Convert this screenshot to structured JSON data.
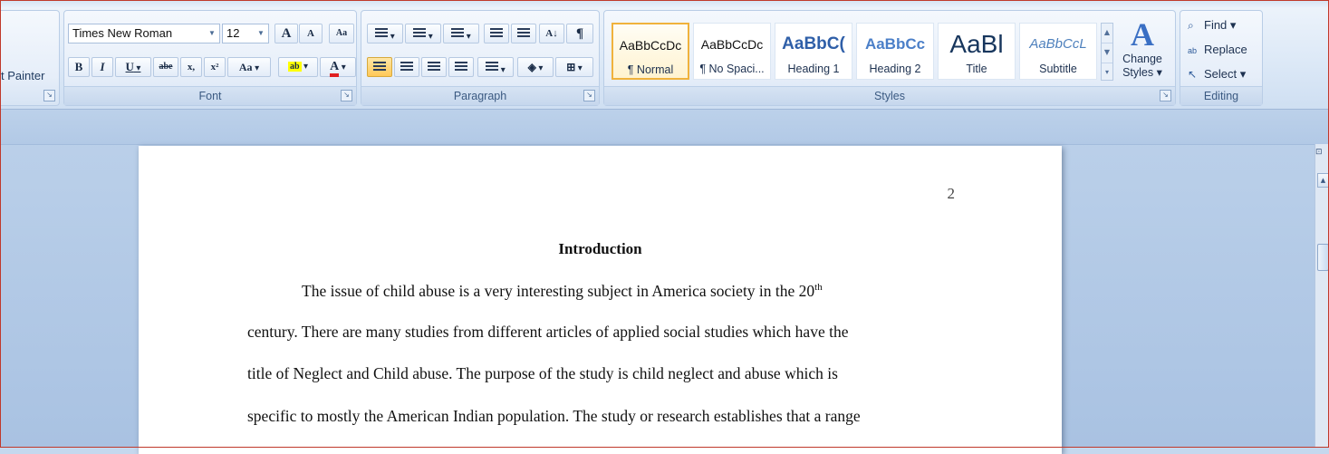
{
  "clipboard": {
    "painter_label": "t Painter"
  },
  "font": {
    "group_label": "Font",
    "face": "Times New Roman",
    "size": "12",
    "grow_label": "A",
    "shrink_label": "A",
    "clear_label": "Aa",
    "bold": "B",
    "italic": "I",
    "underline": "U",
    "strike": "abe",
    "subscript": "x,",
    "superscript": "x²",
    "change_case": "Aa",
    "highlight": "ab",
    "font_color": "A"
  },
  "paragraph": {
    "group_label": "Paragraph",
    "show_marks": "¶",
    "sort": "A↓"
  },
  "styles": {
    "group_label": "Styles",
    "tiles": [
      {
        "preview": "AaBbCcDc",
        "name": "¶ Normal"
      },
      {
        "preview": "AaBbCcDc",
        "name": "¶ No Spaci..."
      },
      {
        "preview": "AaBbC(",
        "name": "Heading 1"
      },
      {
        "preview": "AaBbCc",
        "name": "Heading 2"
      },
      {
        "preview": "AaBl",
        "name": "Title"
      },
      {
        "preview": "AaBbCcL",
        "name": "Subtitle"
      }
    ],
    "change_styles": {
      "line1": "Change",
      "line2": "Styles ▾"
    }
  },
  "editing": {
    "group_label": "Editing",
    "find": "Find ▾",
    "replace": "Replace",
    "select": "Select ▾"
  },
  "document": {
    "page_number": "2",
    "heading": "Introduction",
    "lines": [
      "The issue of child abuse is a very interesting subject in America society in the 20",
      "century. There are many studies from different articles of applied social studies which have the",
      "title of Neglect and Child abuse. The purpose of the study is child neglect and abuse which is",
      "specific to mostly the American Indian population. The study or research establishes that a range"
    ],
    "superscript": "th"
  },
  "colors": {
    "accent": "#f0b23c",
    "highlight_yellow": "#ffff00",
    "font_red": "#e02020"
  }
}
